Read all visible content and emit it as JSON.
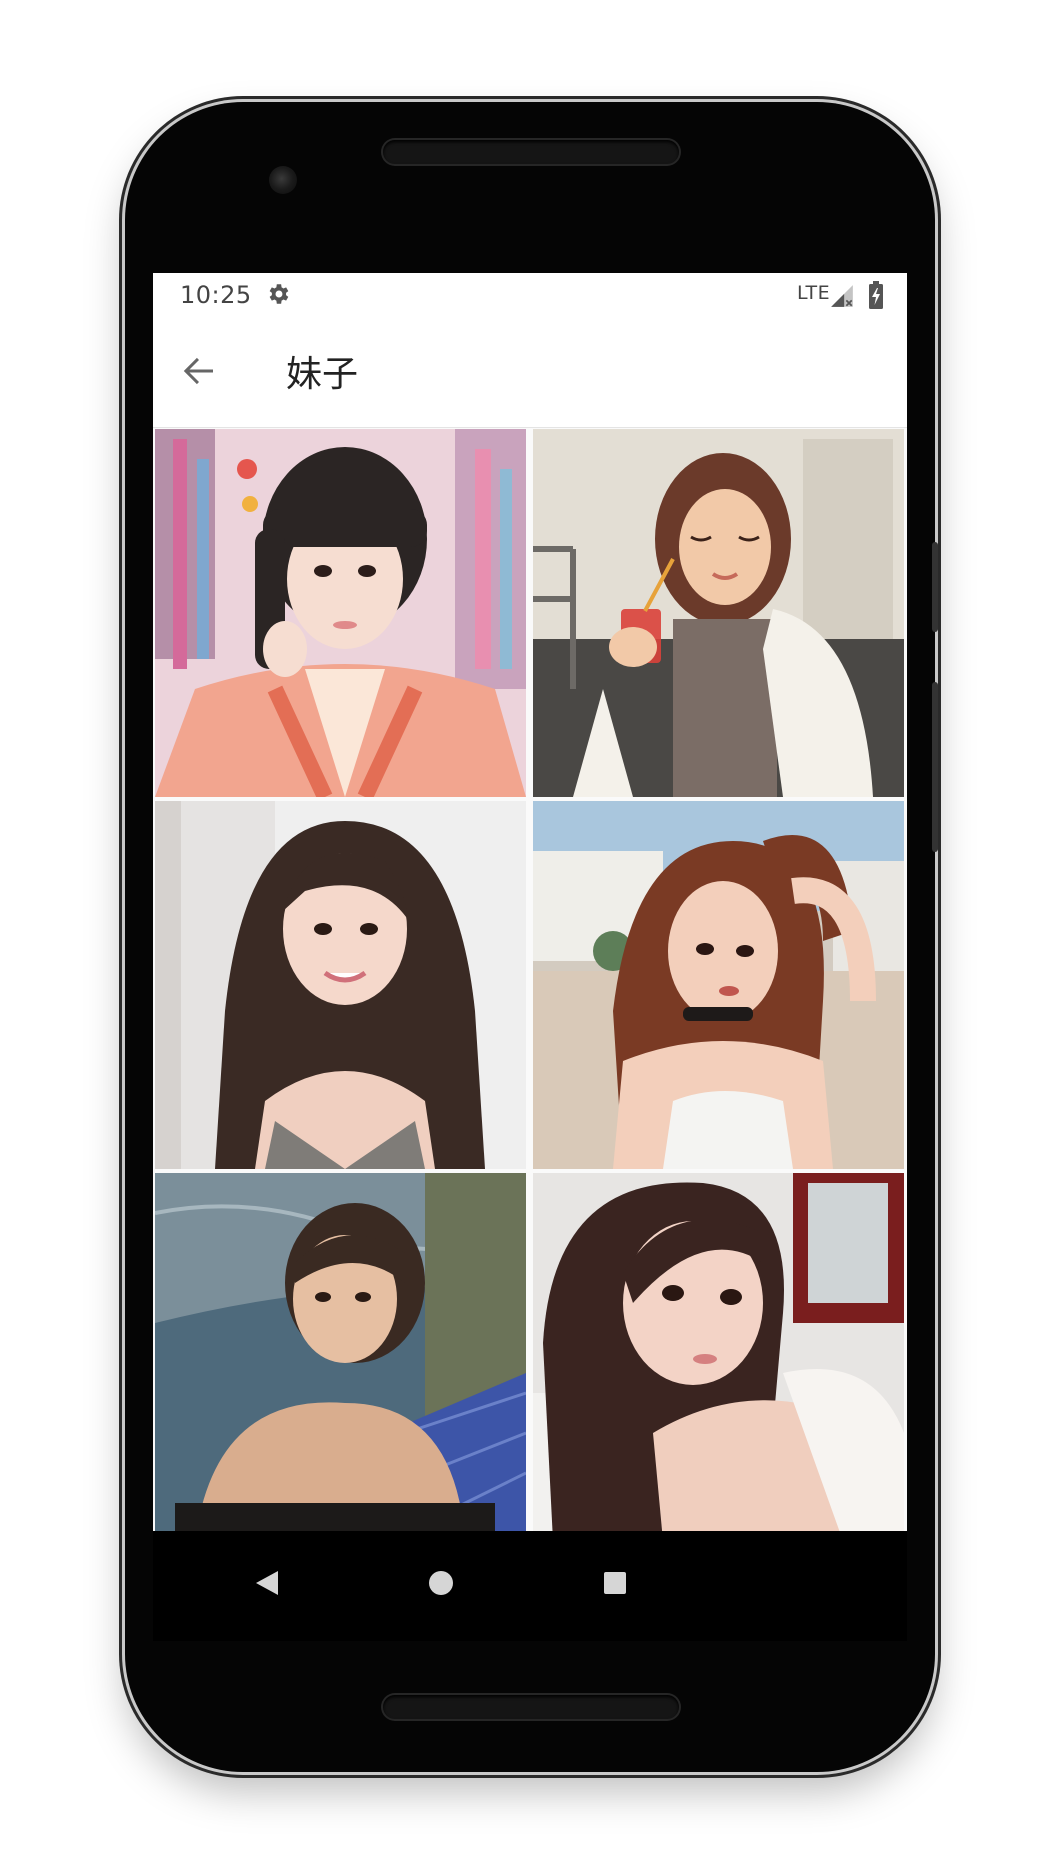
{
  "status_bar": {
    "time": "10:25",
    "network": "LTE",
    "icons": [
      "settings-gear-icon",
      "signal-icon",
      "battery-charging-icon"
    ]
  },
  "toolbar": {
    "title": "妹子",
    "back_icon": "arrow-back-icon"
  },
  "gallery": {
    "photos": [
      {
        "subject": "kimono-selfie",
        "bg": "#e9c6d2"
      },
      {
        "subject": "drink-sunlight",
        "bg": "#d8d4cc"
      },
      {
        "subject": "long-hair-smile",
        "bg": "#eeeeee"
      },
      {
        "subject": "patio-hand-in-hair",
        "bg": "#d8d0c6"
      },
      {
        "subject": "pool-selfie",
        "bg": "#3a5566"
      },
      {
        "subject": "close-up-selfie",
        "bg": "#e6e4e2"
      }
    ]
  },
  "nav_bar": {
    "buttons": [
      "back-triangle-icon",
      "home-circle-icon",
      "recents-square-icon"
    ]
  }
}
